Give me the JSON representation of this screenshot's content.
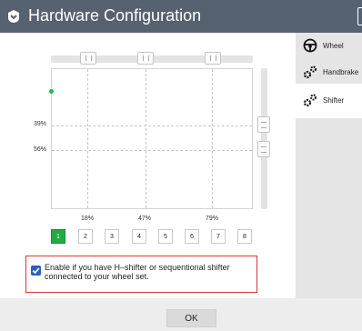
{
  "window": {
    "title": "Hardware Configuration",
    "title_icon": "chevron-shield-icon",
    "close_icon": "close-icon"
  },
  "sidebar": {
    "items": [
      {
        "label": "Wheel",
        "icon": "steering-wheel-icon",
        "active": false
      },
      {
        "label": "Handbrake",
        "icon": "gears-icon",
        "active": false
      },
      {
        "label": "Shifter",
        "icon": "gears-icon",
        "active": true
      }
    ]
  },
  "plot": {
    "y_labels": [
      "39%",
      "56%"
    ],
    "x_labels": [
      "18%",
      "47%",
      "79%"
    ]
  },
  "gears": {
    "items": [
      "1",
      "2",
      "3",
      "4",
      "5",
      "6",
      "7",
      "8"
    ],
    "selected": "1"
  },
  "option": {
    "checked": true,
    "text": "Enable if you have H–shifter or sequentional shifter connected to your wheel set."
  },
  "footer": {
    "ok_label": "OK"
  },
  "colors": {
    "titlebar": "#566270",
    "accent": "#22aa44",
    "highlight_border": "#d9363e",
    "checkbox": "#2b5fc4"
  }
}
